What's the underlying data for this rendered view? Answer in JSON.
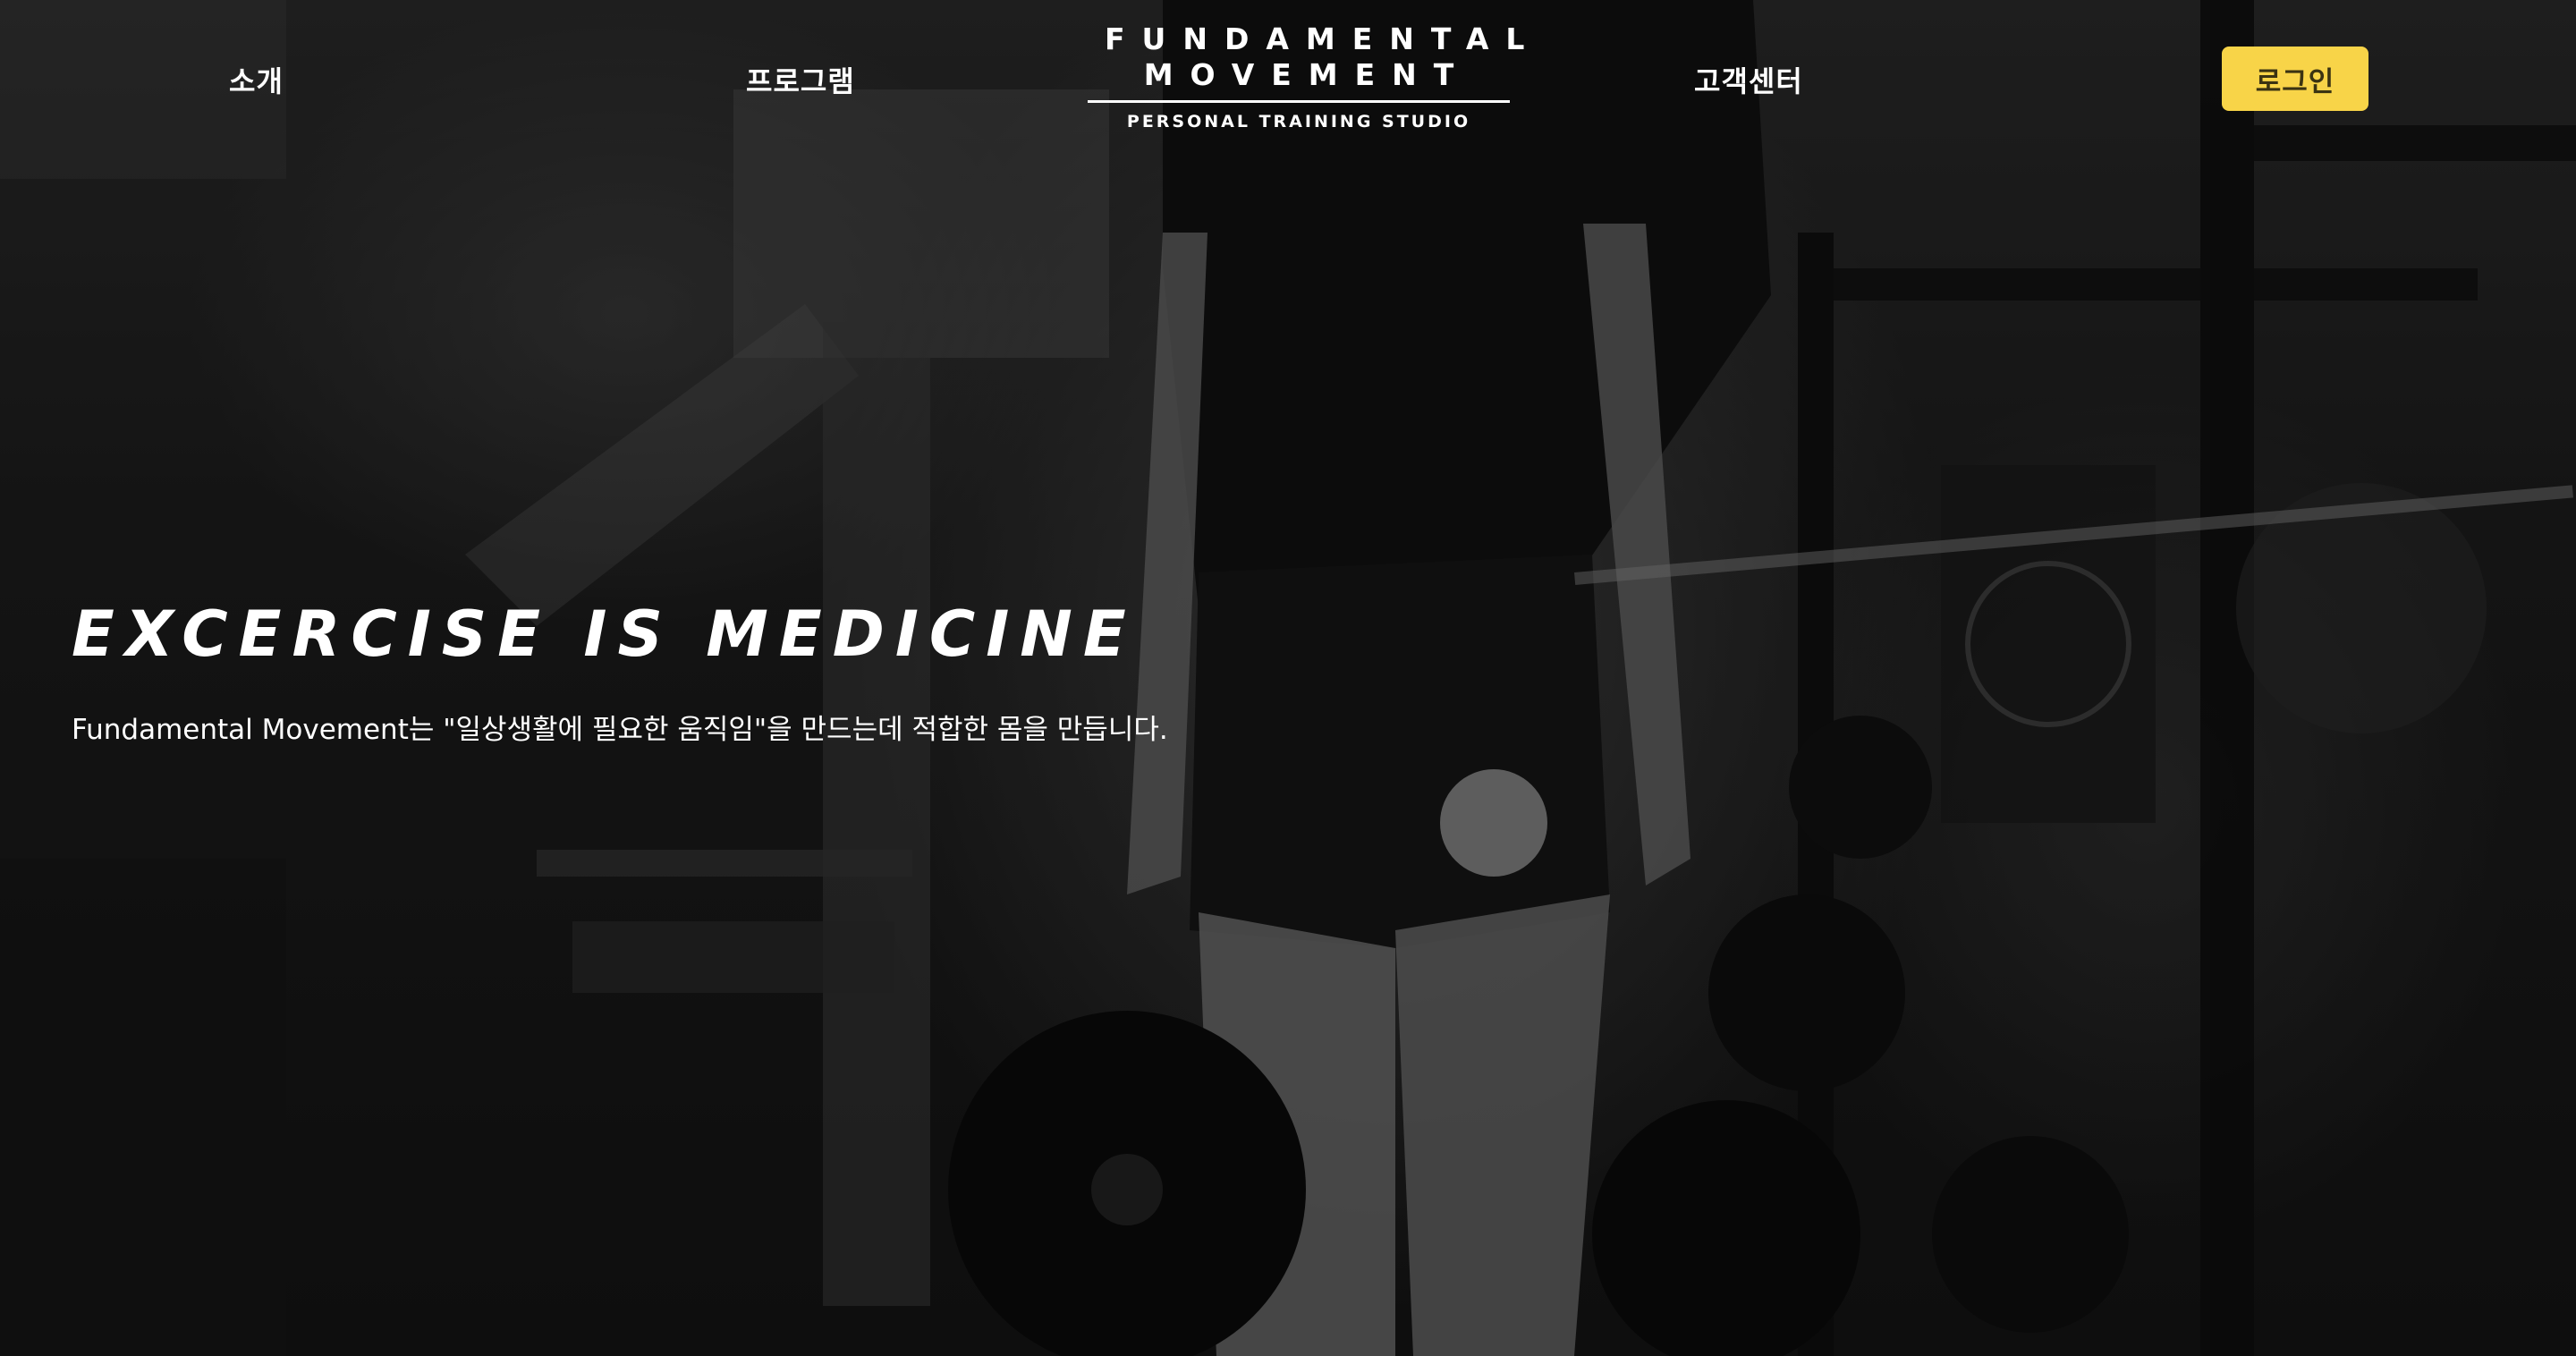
{
  "nav": {
    "intro": "소개",
    "program": "프로그램",
    "support": "고객센터",
    "login": "로그인"
  },
  "logo": {
    "line1": "FUNDAMENTAL",
    "line2": "MOVEMENT",
    "sub": "PERSONAL TRAINING STUDIO"
  },
  "hero": {
    "headline": "EXCERCISE IS MEDICINE",
    "tagline": "Fundamental Movement는 \"일상생활에 필요한 움직임\"을 만드는데 적합한 몸을 만듭니다."
  },
  "colors": {
    "accent": "#f8d448",
    "text": "#ffffff"
  }
}
